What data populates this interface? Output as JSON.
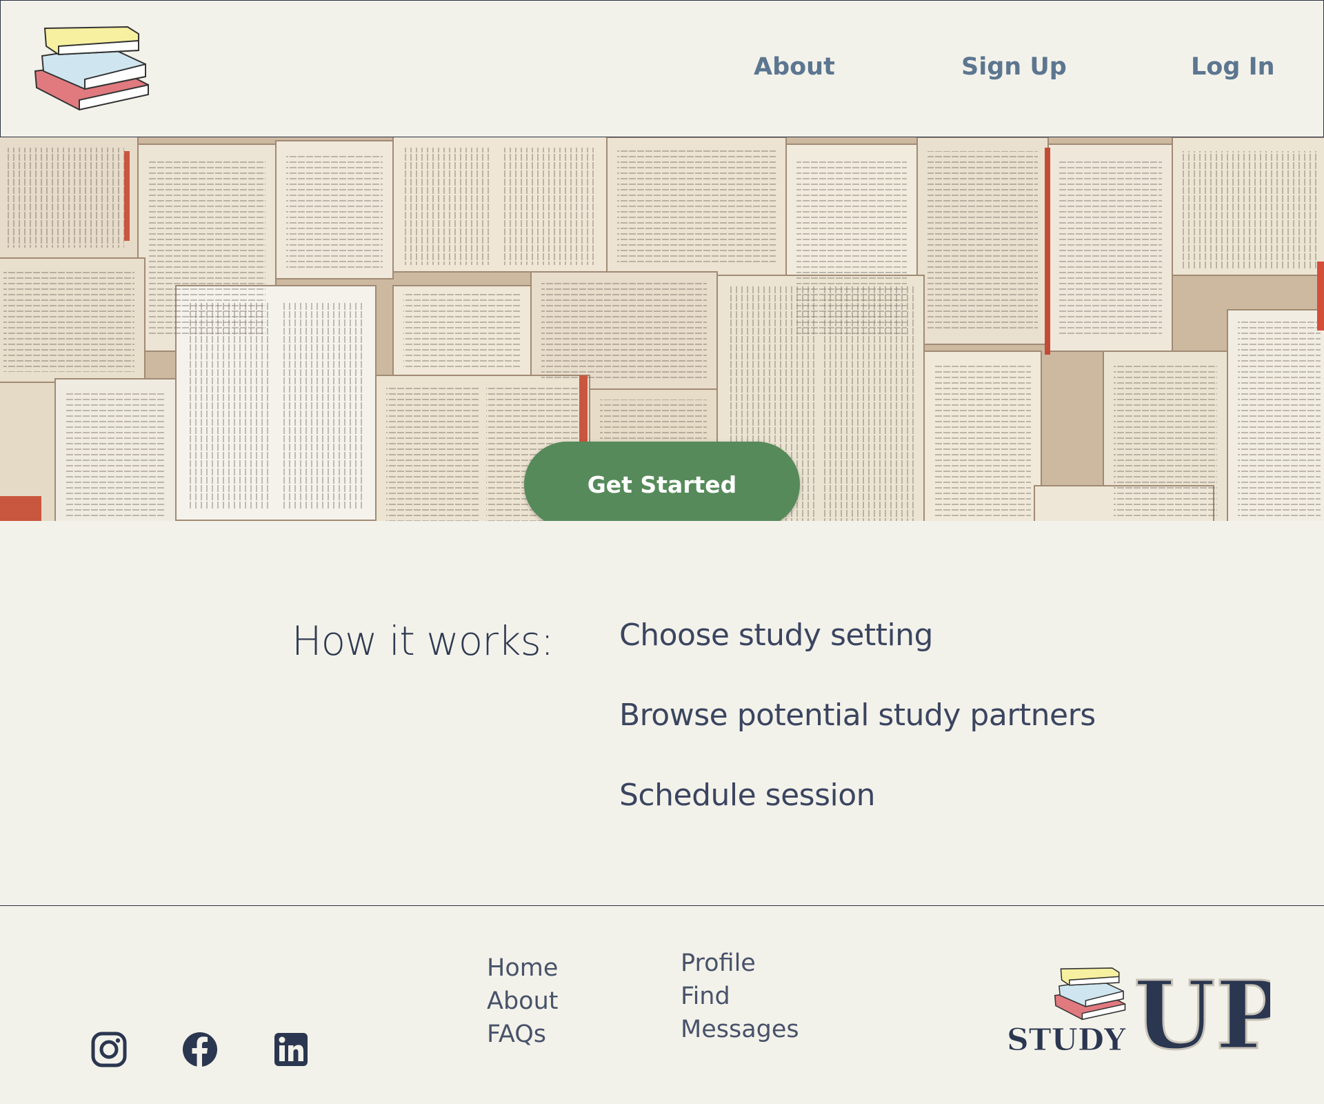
{
  "header": {
    "nav": {
      "about": "About",
      "signup": "Sign Up",
      "login": "Log In"
    }
  },
  "hero": {
    "cta_label": "Get Started"
  },
  "how": {
    "title": "How it works:",
    "steps": [
      "Choose study setting",
      "Browse potential study partners",
      "Schedule session"
    ]
  },
  "footer": {
    "col1": [
      "Home",
      "About",
      "FAQs"
    ],
    "col2": [
      "Profile",
      "Find",
      "Messages"
    ],
    "social": [
      "instagram-icon",
      "facebook-icon",
      "linkedin-icon"
    ],
    "brand": {
      "small": "STUDY",
      "big": "UP"
    }
  },
  "colors": {
    "background": "#f3f2ea",
    "nav_text": "#5c7690",
    "cta": "#568a5a",
    "text_dark": "#2f3a52"
  }
}
